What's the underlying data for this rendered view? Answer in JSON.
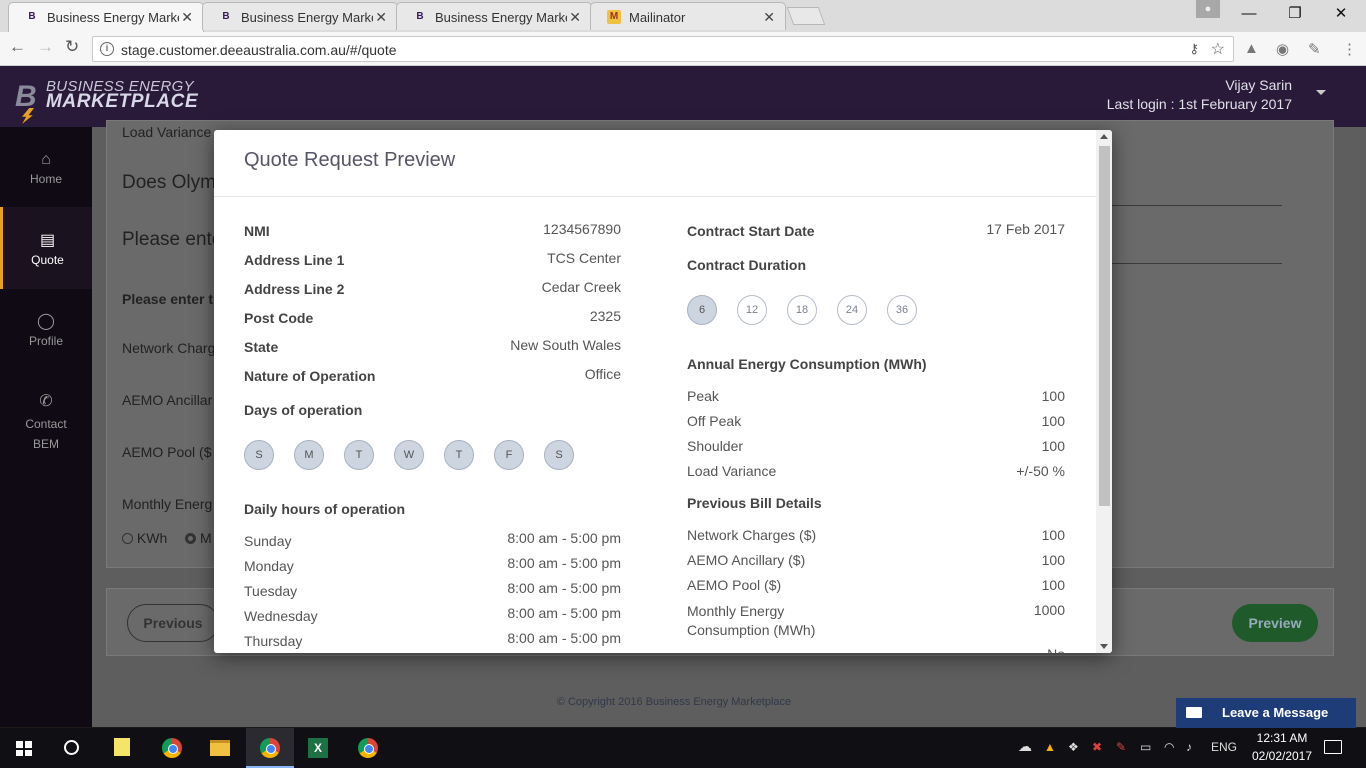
{
  "browser": {
    "tabs": [
      {
        "title": "Business Energy Marketp",
        "active": true
      },
      {
        "title": "Business Energy Marketp",
        "active": false
      },
      {
        "title": "Business Energy Marketp",
        "active": false
      },
      {
        "title": "Mailinator",
        "active": false
      }
    ],
    "url": "stage.customer.deeaustralia.com.au/#/quote"
  },
  "header": {
    "brand_line1": "BUSINESS ENERGY",
    "brand_line2": "MARKETPLACE",
    "user_name": "Vijay Sarin",
    "last_login": "Last login : 1st February 2017"
  },
  "sidebar": {
    "items": [
      {
        "label": "Home",
        "icon": "home-icon",
        "active": false
      },
      {
        "label": "Quote",
        "icon": "quote-icon",
        "active": true
      },
      {
        "label": "Profile",
        "icon": "profile-icon",
        "active": false
      },
      {
        "label": "Contact BEM",
        "icon": "contact-icon",
        "active": false
      }
    ]
  },
  "background": {
    "load_variance": "Load Variance",
    "question1": "Does Olym",
    "question2": "Please ente",
    "enter_label": "Please enter t",
    "network": "Network Charg",
    "aemo_anc": "AEMO Ancillar",
    "aemo_pool": "AEMO Pool ($",
    "monthly": "Monthly Energ",
    "kwh": "KWh",
    "m": "M",
    "prev_button": "Previous",
    "preview_button": "Preview",
    "copyright": "© Copyright 2016 Business Energy Marketplace"
  },
  "modal": {
    "title": "Quote Request Preview",
    "left": {
      "fields": [
        {
          "label": "NMI",
          "value": "1234567890"
        },
        {
          "label": "Address Line 1",
          "value": "TCS Center"
        },
        {
          "label": "Address Line 2",
          "value": "Cedar Creek"
        },
        {
          "label": "Post Code",
          "value": "2325"
        },
        {
          "label": "State",
          "value": "New South Wales"
        },
        {
          "label": "Nature of Operation",
          "value": "Office"
        }
      ],
      "days_heading": "Days of operation",
      "days": [
        "S",
        "M",
        "T",
        "W",
        "T",
        "F",
        "S"
      ],
      "hours_heading": "Daily hours of operation",
      "hours": [
        {
          "day": "Sunday",
          "time": "8:00 am - 5:00 pm"
        },
        {
          "day": "Monday",
          "time": "8:00 am - 5:00 pm"
        },
        {
          "day": "Tuesday",
          "time": "8:00 am - 5:00 pm"
        },
        {
          "day": "Wednesday",
          "time": "8:00 am - 5:00 pm"
        },
        {
          "day": "Thursday",
          "time": "8:00 am - 5:00 pm"
        }
      ]
    },
    "right": {
      "start_label": "Contract Start Date",
      "start_value": "17 Feb 2017",
      "duration_label": "Contract Duration",
      "durations": [
        {
          "value": "6",
          "selected": true
        },
        {
          "value": "12",
          "selected": false
        },
        {
          "value": "18",
          "selected": false
        },
        {
          "value": "24",
          "selected": false
        },
        {
          "value": "36",
          "selected": false
        }
      ],
      "consumption_heading": "Annual Energy Consumption (MWh)",
      "consumption": [
        {
          "label": "Peak",
          "value": "100"
        },
        {
          "label": "Off Peak",
          "value": "100"
        },
        {
          "label": "Shoulder",
          "value": "100"
        },
        {
          "label": "Load Variance",
          "value": "+/-50 %"
        }
      ],
      "bill_heading": "Previous Bill Details",
      "bill": [
        {
          "label": "Network Charges ($)",
          "value": "100"
        },
        {
          "label": "AEMO Ancillary ($)",
          "value": "100"
        },
        {
          "label": "AEMO Pool ($)",
          "value": "100"
        },
        {
          "label": "Monthly Energy Consumption (MWh)",
          "value": "1000"
        }
      ],
      "cut_value": "No"
    }
  },
  "widget": {
    "leave_message": "Leave a Message"
  },
  "taskbar": {
    "lang": "ENG",
    "time": "12:31 AM",
    "date": "02/02/2017"
  },
  "colors": {
    "header_bg": "#2a1a3a",
    "accent": "#e8a020",
    "preview_green": "#1e5a2a",
    "widget_blue": "#1e3c78"
  }
}
